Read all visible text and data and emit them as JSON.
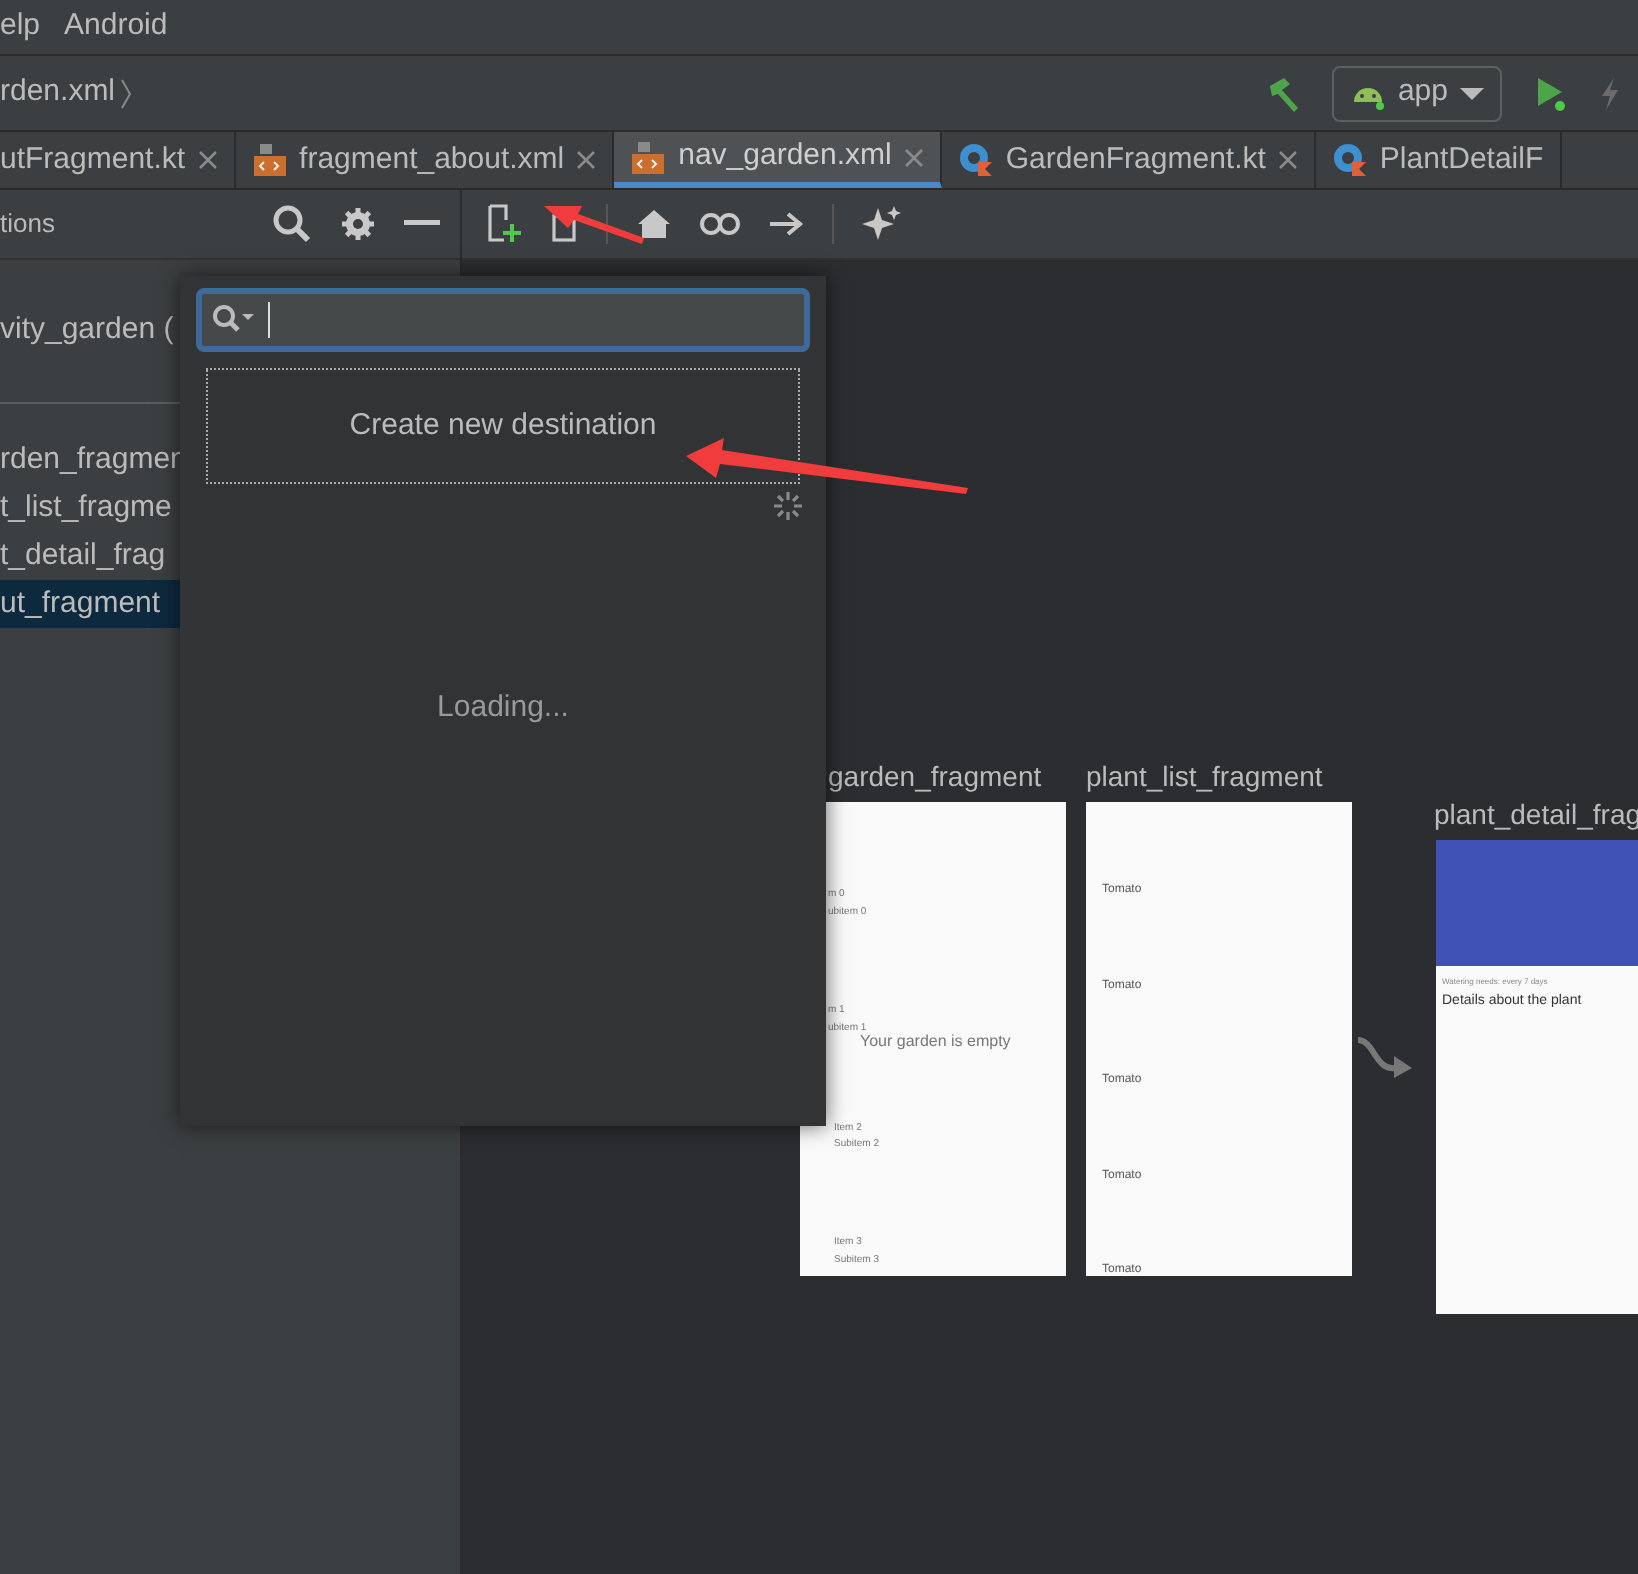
{
  "menu_bar": [
    "elp",
    "Android"
  ],
  "breadcrumb": "rden.xml",
  "run_config": "app",
  "tabs": [
    {
      "label": "utFragment.kt",
      "kind": "plain",
      "selected": false
    },
    {
      "label": "fragment_about.xml",
      "kind": "xml",
      "selected": false
    },
    {
      "label": "nav_garden.xml",
      "kind": "xml",
      "selected": true
    },
    {
      "label": "GardenFragment.kt",
      "kind": "kotlin",
      "selected": false
    },
    {
      "label": "PlantDetailF",
      "kind": "kotlin",
      "selected": false
    }
  ],
  "panel": {
    "title": "tions",
    "host": "vity_garden (",
    "destinations": [
      {
        "label": "rden_fragmen",
        "selected": false
      },
      {
        "label": "t_list_fragme",
        "selected": false
      },
      {
        "label": "t_detail_frag",
        "selected": false
      },
      {
        "label": "ut_fragment",
        "selected": true
      }
    ]
  },
  "popup": {
    "create_label": "Create new destination",
    "loading": "Loading..."
  },
  "graph": {
    "destinations": [
      {
        "kind": "garden",
        "label": "garden_fragment",
        "empty_text": "Your garden is empty",
        "items": [
          "m 0",
          "ubitem 0",
          "m 1",
          "ubitem 1",
          "Item 2",
          "Subitem 2",
          "Item 3",
          "Subitem 3"
        ]
      },
      {
        "kind": "list",
        "label": "plant_list_fragment",
        "items": [
          "Tomato",
          "Tomato",
          "Tomato",
          "Tomato",
          "Tomato"
        ]
      },
      {
        "kind": "detail",
        "label": "plant_detail_frag",
        "subtitle": "Watering needs: every 7 days",
        "body": "Details about the plant"
      }
    ]
  }
}
